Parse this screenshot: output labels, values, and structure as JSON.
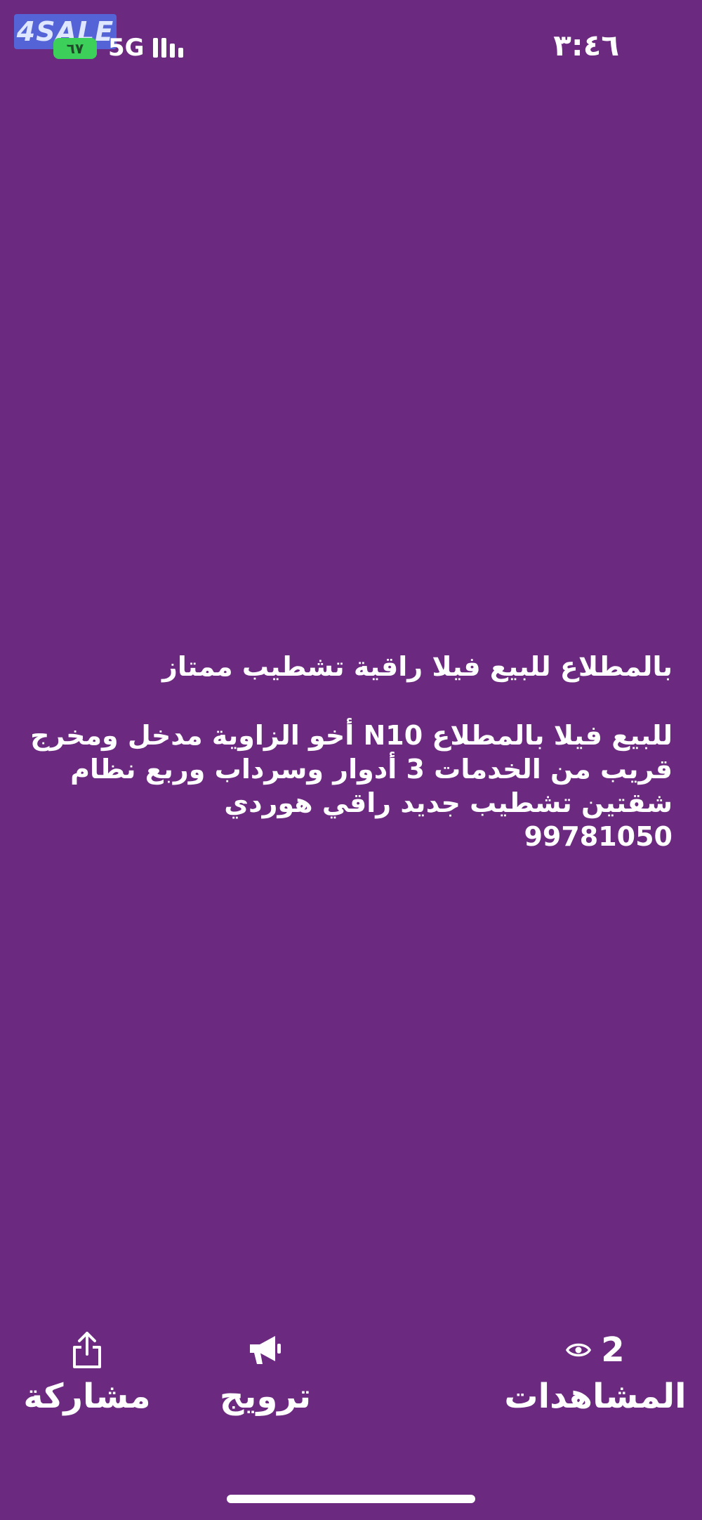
{
  "status_bar": {
    "watermark": "4SALE",
    "battery": "٦٧",
    "network": "5G",
    "time": "٣:٤٦"
  },
  "post": {
    "title": "بالمطلاع للبيع فيلا راقية تشطيب ممتاز",
    "lines": [
      "للبيع فيلا بالمطلاع N10   أخو الزاوية مدخل ومخرج",
      "قريب من الخدمات 3 أدوار وسرداب وربع نظام",
      "شقتين تشطيب جديد راقي هوردي"
    ],
    "phone": "99781050"
  },
  "actions": {
    "share_label": "مشاركة",
    "share_icon": "share-icon",
    "promote_label": "ترويج",
    "promote_icon": "megaphone-icon",
    "views_count": "2",
    "views_icon": "eye-icon",
    "views_label": "المشاهدات"
  }
}
